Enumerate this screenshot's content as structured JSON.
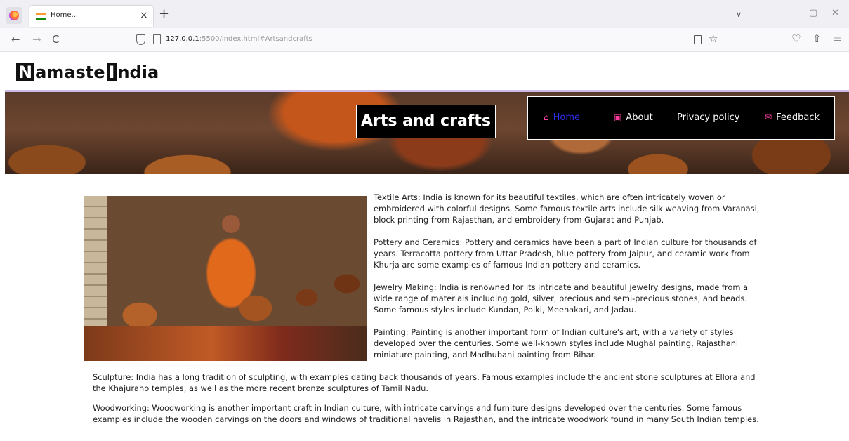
{
  "browser": {
    "tab_title": "Home...",
    "tab_close": "×",
    "new_tab": "+",
    "tab_list": "∨",
    "minimize": "–",
    "restore": "▢",
    "close": "✕",
    "back": "←",
    "forward": "→",
    "reload": "C",
    "url_host": "127.0.0.1",
    "url_rest": ":5500/index.html#Artsandcrafts",
    "bookmark_star": "☆",
    "pocket": "♡",
    "share": "⇧",
    "menu": "≡"
  },
  "site": {
    "logo_initial_1": "N",
    "logo_word_1": "amaste",
    "logo_initial_2": "I",
    "logo_word_2": "ndia"
  },
  "banner": {
    "title": "Arts and crafts",
    "nav": [
      {
        "label": "Home",
        "icon": "home-icon",
        "glyph": "⌂"
      },
      {
        "label": "About",
        "icon": "id-card-icon",
        "glyph": "▣"
      },
      {
        "label": "Privacy policy",
        "icon": "",
        "glyph": ""
      },
      {
        "label": "Feedback",
        "icon": "envelope-icon",
        "glyph": "✉"
      }
    ],
    "active_color": "#2f2ff0",
    "icon_color": "#ff3c9e"
  },
  "content": {
    "image_name": "woman making pottery",
    "paragraphs": [
      "Textile Arts: India is known for its beautiful textiles, which are often intricately woven or embroidered with colorful designs. Some famous textile arts include silk weaving from Varanasi, block printing from Rajasthan, and embroidery from Gujarat and Punjab.",
      "Pottery and Ceramics: Pottery and ceramics have been a part of Indian culture for thousands of years. Terracotta pottery from Uttar Pradesh, blue pottery from Jaipur, and ceramic work from Khurja are some examples of famous Indian pottery and ceramics.",
      "Jewelry Making: India is renowned for its intricate and beautiful jewelry designs, made from a wide range of materials including gold, silver, precious and semi-precious stones, and beads. Some famous styles include Kundan, Polki, Meenakari, and Jadau.",
      "Painting: Painting is another important form of Indian culture's art, with a variety of styles developed over the centuries. Some well-known styles include Mughal painting, Rajasthani miniature painting, and Madhubani painting from Bihar.",
      "Sculpture: India has a long tradition of sculpting, with examples dating back thousands of years. Famous examples include the ancient stone sculptures at Ellora and the Khajuraho temples, as well as the more recent bronze sculptures of Tamil Nadu.",
      "Woodworking: Woodworking is another important craft in Indian culture, with intricate carvings and furniture designs developed over the centuries. Some famous examples include the wooden carvings on the doors and windows of traditional havelis in Rajasthan, and the intricate woodwork found in many South Indian temples."
    ]
  }
}
